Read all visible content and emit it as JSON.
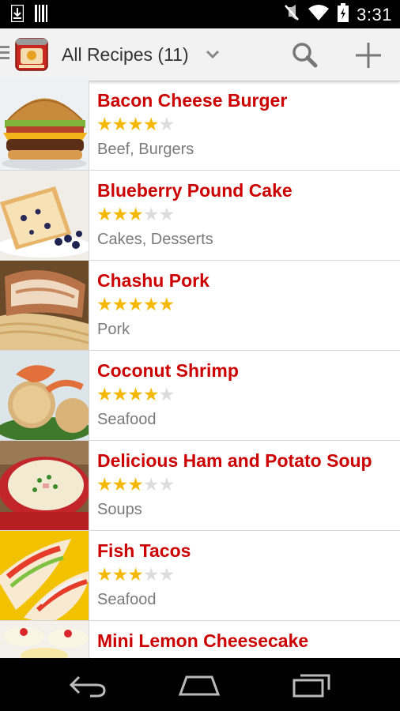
{
  "status_bar": {
    "time": "3:31",
    "icons": [
      "download-icon",
      "barcode-icon",
      "mute-icon",
      "wifi-icon",
      "battery-icon"
    ]
  },
  "action_bar": {
    "title": "All Recipes (11)",
    "app_icon": "paprika-app-icon",
    "actions": [
      "search-icon",
      "add-icon"
    ]
  },
  "recipes": [
    {
      "title": "Bacon Cheese Burger",
      "rating": 4,
      "categories": "Beef, Burgers",
      "image": "burger"
    },
    {
      "title": "Blueberry Pound Cake",
      "rating": 3,
      "categories": "Cakes, Desserts",
      "image": "cake"
    },
    {
      "title": "Chashu Pork",
      "rating": 5,
      "categories": "Pork",
      "image": "pork"
    },
    {
      "title": "Coconut Shrimp",
      "rating": 4,
      "categories": "Seafood",
      "image": "shrimp"
    },
    {
      "title": "Delicious Ham and Potato Soup",
      "rating": 3,
      "categories": "Soups",
      "image": "soup"
    },
    {
      "title": "Fish Tacos",
      "rating": 3,
      "categories": "Seafood",
      "image": "tacos"
    },
    {
      "title": "Mini Lemon Cheesecake",
      "rating": 0,
      "categories": "",
      "image": "cheesecake"
    }
  ],
  "colors": {
    "title_red": "#cc0000",
    "star_gold": "#f5b800",
    "star_empty": "#dcdcdc",
    "category_gray": "#7a7a7a"
  },
  "nav_bar": {
    "buttons": [
      "back-icon",
      "home-icon",
      "recent-apps-icon"
    ]
  }
}
